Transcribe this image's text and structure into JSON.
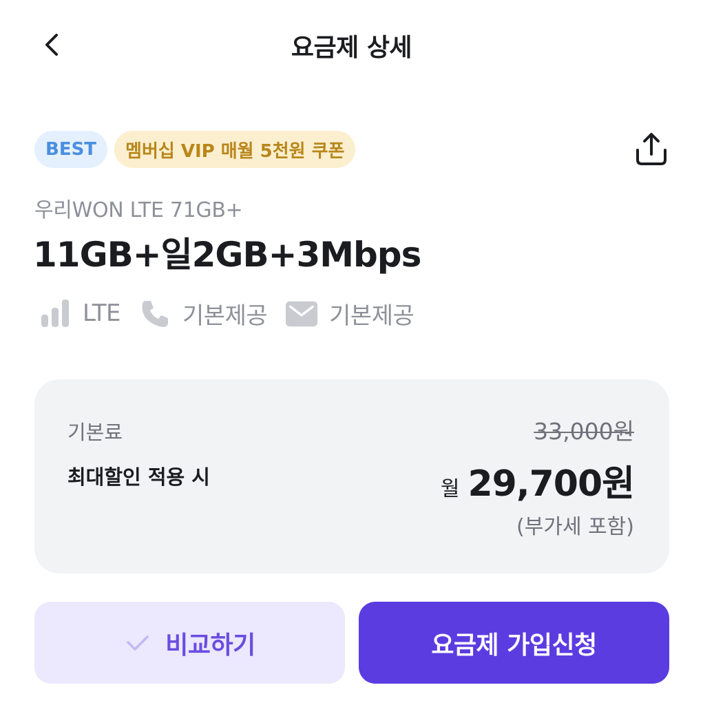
{
  "header": {
    "title": "요금제 상세",
    "back_icon": "chevron-left-icon"
  },
  "badges": [
    {
      "label": "BEST",
      "color": "#4a8ee0",
      "bg": "#e4f0fd"
    },
    {
      "label": "멤버십 VIP 매월 5천원 쿠폰",
      "color": "#b8861a",
      "bg": "#fcefcf"
    }
  ],
  "share_icon": "share-icon",
  "plan": {
    "subtitle": "우리WON LTE 71GB+",
    "name": "11GB+일2GB+3Mbps"
  },
  "features": [
    {
      "icon": "signal-bars-icon",
      "label": "LTE"
    },
    {
      "icon": "phone-icon",
      "label": "기본제공"
    },
    {
      "icon": "mail-icon",
      "label": "기본제공"
    }
  ],
  "price": {
    "base_label": "기본료",
    "discount_label": "최대할인 적용 시",
    "original": "33,000원",
    "prefix": "월",
    "final": "29,700원",
    "vat_note": "(부가세 포함)"
  },
  "actions": {
    "compare_label": "비교하기",
    "signup_label": "요금제 가입신청",
    "accent_color": "#5b3ce1"
  }
}
